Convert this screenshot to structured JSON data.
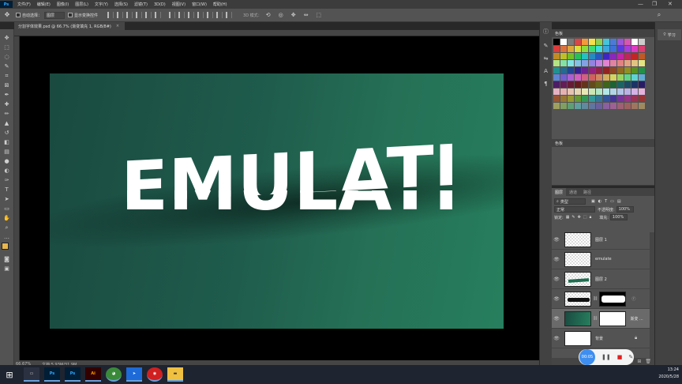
{
  "menubar": {
    "logo": "Ps",
    "items": [
      "文件(F)",
      "编辑(E)",
      "图像(I)",
      "图层(L)",
      "文字(Y)",
      "选择(S)",
      "滤镜(T)",
      "3D(D)",
      "视图(V)",
      "窗口(W)",
      "帮助(H)"
    ],
    "minimize": "—",
    "maximize": "❐",
    "close": "✕"
  },
  "options": {
    "auto_select_label": "自动选择：",
    "auto_select_value": "图层",
    "show_transform_label": "显示变换控件",
    "mode_3d_label": "3D 模式："
  },
  "document": {
    "tab_title": "分割字体效果.psd @ 66.7% (渐变填充 1, RGB/8#)",
    "tab_close": "×",
    "canvas_text": "EMULATE"
  },
  "status": {
    "zoom": "66.67%",
    "doc_info": "文档:5.93M/31.9M"
  },
  "panels": {
    "swatches_title": "色板",
    "color_title": "色板",
    "learn_label": "学习",
    "layers_tabs": [
      "图层",
      "通道",
      "路径"
    ],
    "filter_kind": "类型",
    "blend_mode": "正常",
    "opacity_label": "不透明度:",
    "opacity_value": "100%",
    "lock_label": "锁定:",
    "fill_label": "填充:",
    "fill_value": "100%"
  },
  "layers": [
    {
      "name": "图层 1",
      "thumb": "checker",
      "mask": false
    },
    {
      "name": "emulate",
      "thumb": "checker",
      "mask": false
    },
    {
      "name": "图层 2",
      "thumb": "checker-green",
      "mask": false
    },
    {
      "name": "",
      "thumb": "checker-black",
      "mask": true
    },
    {
      "name": "渐变 ...",
      "thumb": "green",
      "mask": true
    },
    {
      "name": "背景",
      "thumb": "white",
      "mask": false
    }
  ],
  "recorder": {
    "time": "00:05"
  },
  "taskbar": {
    "apps": [
      "Ps",
      "Ps",
      "Ai"
    ],
    "time": "13:24",
    "date": "2020/5/28"
  },
  "colors": {
    "accent": "#31a8ff",
    "ai_orange": "#ff9a00",
    "canvas_green": "#1f5c4c"
  }
}
